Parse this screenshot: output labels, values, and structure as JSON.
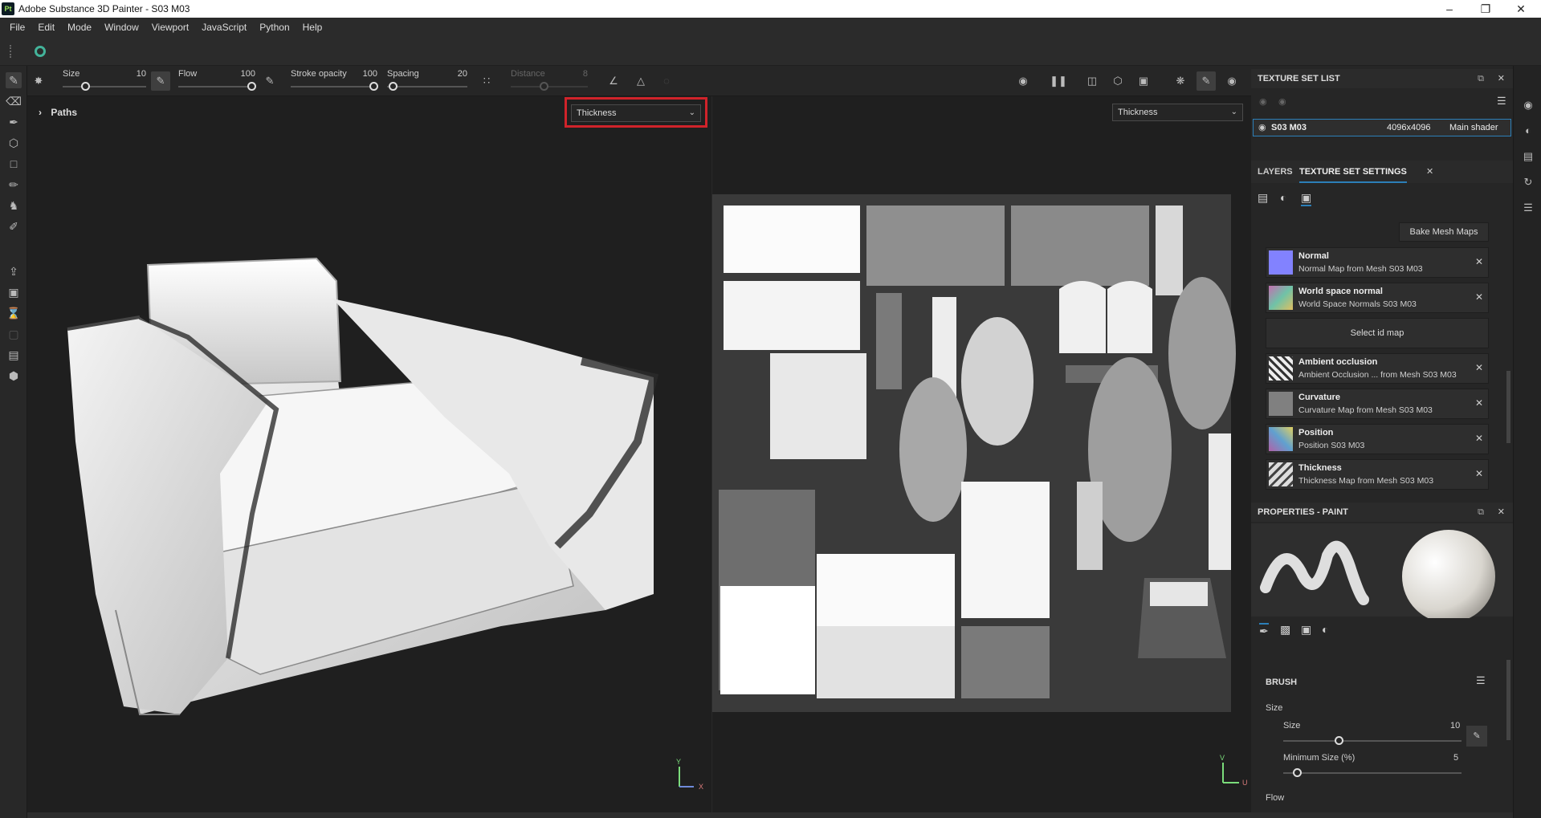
{
  "window": {
    "title": "Adobe Substance 3D Painter - S03 M03",
    "app_icon": "Pt",
    "controls": [
      "minimize-icon",
      "maximize-icon",
      "close-icon"
    ]
  },
  "menu": [
    "File",
    "Edit",
    "Mode",
    "Window",
    "Viewport",
    "JavaScript",
    "Python",
    "Help"
  ],
  "brush_toolbar": {
    "size": {
      "label": "Size",
      "value": "10",
      "level": 0.1
    },
    "flow": {
      "label": "Flow",
      "value": "100",
      "level": 1.0
    },
    "stroke_opacity": {
      "label": "Stroke opacity",
      "value": "100",
      "level": 1.0
    },
    "spacing": {
      "label": "Spacing",
      "value": "20",
      "level": 0.02
    },
    "distance": {
      "label": "Distance",
      "value": "8",
      "level": 0.4,
      "disabled": true
    }
  },
  "viewport3d": {
    "paths_label": "Paths",
    "channel_select": "Thickness"
  },
  "viewport2d": {
    "channel_select": "Thickness"
  },
  "texture_set_list": {
    "title": "TEXTURE SET LIST",
    "row": {
      "name": "S03 M03",
      "resolution": "4096x4096",
      "shader": "Main shader"
    }
  },
  "tabs": {
    "layers": "LAYERS",
    "texture_set_settings": "TEXTURE SET SETTINGS"
  },
  "bake_button": "Bake Mesh Maps",
  "mesh_maps": [
    {
      "name": "Normal",
      "desc": "Normal Map from Mesh S03 M03",
      "color": "#8282ff"
    },
    {
      "name": "World space normal",
      "desc": "World Space Normals S03 M03",
      "color": "#c26fb0"
    },
    {
      "name": "Ambient occlusion",
      "desc": "Ambient Occlusion ... from Mesh S03 M03",
      "color": "#e8e8e8"
    },
    {
      "name": "Curvature",
      "desc": "Curvature Map from Mesh S03 M03",
      "color": "#808080"
    },
    {
      "name": "Position",
      "desc": "Position S03 M03",
      "color": "#b062a8"
    },
    {
      "name": "Thickness",
      "desc": "Thickness Map from Mesh S03 M03",
      "color": "#dcdcdc"
    }
  ],
  "select_id_map": "Select id map",
  "properties": {
    "title": "PROPERTIES - PAINT",
    "section": "BRUSH",
    "size_group": "Size",
    "size": {
      "label": "Size",
      "value": "10",
      "level": 0.3
    },
    "min_size": {
      "label": "Minimum Size (%)",
      "value": "5",
      "level": 0.05
    },
    "flow_group": "Flow"
  },
  "axis_3d": {
    "y": "Y",
    "x": "X"
  },
  "axis_2d": {
    "v": "V",
    "u": "U"
  }
}
